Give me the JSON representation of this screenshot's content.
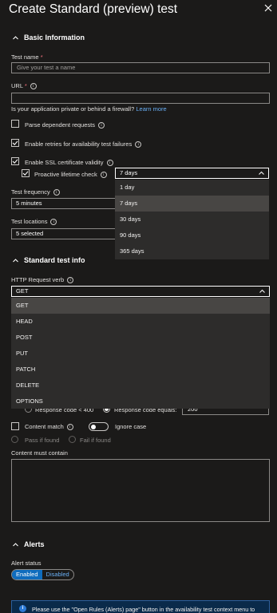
{
  "header": {
    "title": "Create Standard (preview) test"
  },
  "basic": {
    "section_title": "Basic Information",
    "test_name_label": "Test name",
    "required_mark": "*",
    "test_name_placeholder": "Give your test a name",
    "url_label": "URL",
    "url_value": "",
    "private_question": "Is your application private or behind a firewall?",
    "learn_more": "Learn more",
    "parse_label": "Parse dependent requests",
    "parse_checked": false,
    "retries_label": "Enable retries for availability test failures",
    "retries_checked": true,
    "ssl_label": "Enable SSL certificate validity",
    "ssl_checked": true,
    "proactive_label": "Proactive lifetime check",
    "proactive_checked": true,
    "proactive_value": "7 days",
    "proactive_options": [
      "1 day",
      "7 days",
      "30 days",
      "90 days",
      "365 days"
    ],
    "frequency_label": "Test frequency",
    "frequency_value": "5 minutes",
    "locations_label": "Test locations",
    "locations_value": "5 selected"
  },
  "standard": {
    "section_title": "Standard test info",
    "verb_label": "HTTP Request verb",
    "verb_value": "GET",
    "verb_options": [
      "GET",
      "HEAD",
      "POST",
      "PUT",
      "PATCH",
      "DELETE",
      "OPTIONS"
    ],
    "resp_lt_400": "Response code < 400",
    "resp_equals": "Response code equals:",
    "resp_code_value": "200",
    "content_match_label": "Content match",
    "ignore_case_label": "Ignore case",
    "pass_if_found": "Pass if found",
    "fail_if_found": "Fail if found",
    "content_must_contain": "Content must contain"
  },
  "alerts": {
    "section_title": "Alerts",
    "status_label": "Alert status",
    "enabled": "Enabled",
    "disabled": "Disabled",
    "banner_text": "Please use the \"Open Rules (Alerts) page\" button in the availability test context menu to"
  },
  "icons": {
    "close": "close-icon",
    "chevron": "chevron-up-icon",
    "info": "info-icon",
    "check": "checkmark-icon",
    "caret": "chevron-down-icon"
  },
  "colors": {
    "background": "#1b1a19",
    "accent": "#0f6cbd",
    "link": "#69aff5",
    "required": "#f1707b"
  }
}
